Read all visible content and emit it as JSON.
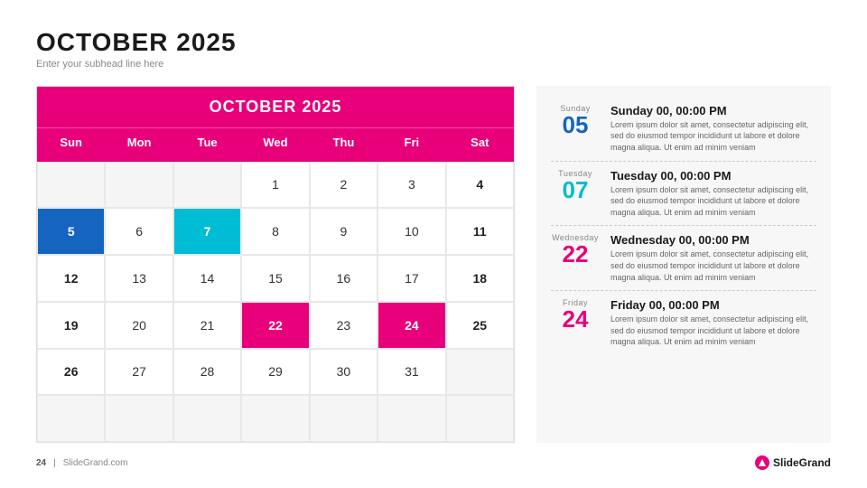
{
  "header": {
    "title": "OCTOBER 2025",
    "subtitle": "Enter your subhead line here"
  },
  "calendar": {
    "title": "OCTOBER 2025",
    "day_headers": [
      "Sun",
      "Mon",
      "Tue",
      "Wed",
      "Thu",
      "Fri",
      "Sat"
    ],
    "weeks": [
      [
        {
          "label": "",
          "type": "empty"
        },
        {
          "label": "",
          "type": "empty"
        },
        {
          "label": "",
          "type": "empty"
        },
        {
          "label": "1",
          "type": "normal"
        },
        {
          "label": "2",
          "type": "normal"
        },
        {
          "label": "3",
          "type": "normal"
        },
        {
          "label": "4",
          "type": "weekend"
        }
      ],
      [
        {
          "label": "5",
          "type": "highlight-darkblue"
        },
        {
          "label": "6",
          "type": "normal"
        },
        {
          "label": "7",
          "type": "highlight-blue"
        },
        {
          "label": "8",
          "type": "normal"
        },
        {
          "label": "9",
          "type": "normal"
        },
        {
          "label": "10",
          "type": "normal"
        },
        {
          "label": "11",
          "type": "weekend"
        }
      ],
      [
        {
          "label": "12",
          "type": "weekend-left"
        },
        {
          "label": "13",
          "type": "normal"
        },
        {
          "label": "14",
          "type": "normal"
        },
        {
          "label": "15",
          "type": "normal"
        },
        {
          "label": "16",
          "type": "normal"
        },
        {
          "label": "17",
          "type": "normal"
        },
        {
          "label": "18",
          "type": "weekend"
        }
      ],
      [
        {
          "label": "19",
          "type": "weekend-left"
        },
        {
          "label": "20",
          "type": "normal"
        },
        {
          "label": "21",
          "type": "normal"
        },
        {
          "label": "22",
          "type": "highlight-pink"
        },
        {
          "label": "23",
          "type": "normal"
        },
        {
          "label": "24",
          "type": "highlight-pink"
        },
        {
          "label": "25",
          "type": "weekend"
        }
      ],
      [
        {
          "label": "26",
          "type": "weekend-left"
        },
        {
          "label": "27",
          "type": "normal"
        },
        {
          "label": "28",
          "type": "normal"
        },
        {
          "label": "29",
          "type": "normal"
        },
        {
          "label": "30",
          "type": "normal"
        },
        {
          "label": "31",
          "type": "normal"
        },
        {
          "label": "",
          "type": "empty"
        }
      ],
      [
        {
          "label": "",
          "type": "empty"
        },
        {
          "label": "",
          "type": "empty"
        },
        {
          "label": "",
          "type": "empty"
        },
        {
          "label": "",
          "type": "empty"
        },
        {
          "label": "",
          "type": "empty"
        },
        {
          "label": "",
          "type": "empty"
        },
        {
          "label": "",
          "type": "empty"
        }
      ]
    ]
  },
  "events": [
    {
      "day_name": "Sunday",
      "day_num": "05",
      "day_num_color": "color-blue",
      "title": "Sunday 00, 00:00 PM",
      "desc": "Lorem ipsum dolor sit amet, consectetur adipiscing elit, sed do eiusmod tempor incididunt ut labore et dolore magna aliqua. Ut enim ad minim veniam"
    },
    {
      "day_name": "Tuesday",
      "day_num": "07",
      "day_num_color": "color-cyan",
      "title": "Tuesday 00, 00:00 PM",
      "desc": "Lorem ipsum dolor sit amet, consectetur adipiscing elit, sed do eiusmod tempor incididunt ut labore et dolore magna aliqua. Ut enim ad minim veniam"
    },
    {
      "day_name": "Wednesday",
      "day_num": "22",
      "day_num_color": "color-pink",
      "title": "Wednesday 00, 00:00 PM",
      "desc": "Lorem ipsum dolor sit amet, consectetur adipiscing elit, sed do eiusmod tempor incididunt ut labore et dolore magna aliqua. Ut enim ad minim veniam"
    },
    {
      "day_name": "Friday",
      "day_num": "24",
      "day_num_color": "color-pink2",
      "title": "Friday 00, 00:00 PM",
      "desc": "Lorem ipsum dolor sit amet, consectetur adipiscing elit, sed do eiusmod tempor incididunt ut labore et dolore magna aliqua. Ut enim ad minim veniam"
    }
  ],
  "footer": {
    "page": "24",
    "divider": "|",
    "site": "SlideGrand.com",
    "brand": "SlideGrand"
  }
}
